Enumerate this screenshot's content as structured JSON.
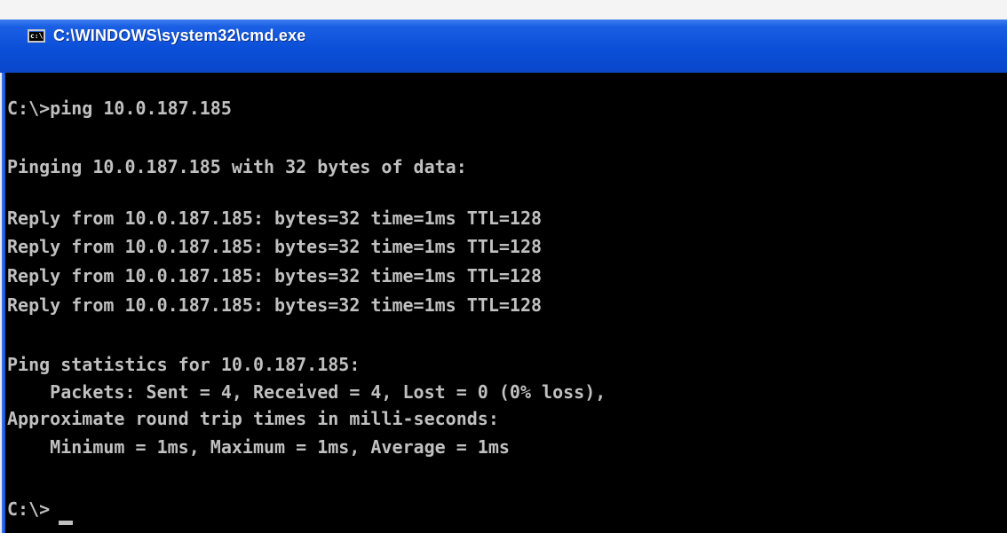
{
  "window": {
    "title": "C:\\WINDOWS\\system32\\cmd.exe",
    "icon_label": "c:\\"
  },
  "console": {
    "lines": [
      "C:\\>ping 10.0.187.185",
      "Pinging 10.0.187.185 with 32 bytes of data:",
      "Reply from 10.0.187.185: bytes=32 time=1ms TTL=128",
      "Reply from 10.0.187.185: bytes=32 time=1ms TTL=128",
      "Reply from 10.0.187.185: bytes=32 time=1ms TTL=128",
      "Reply from 10.0.187.185: bytes=32 time=1ms TTL=128",
      "Ping statistics for 10.0.187.185:",
      "    Packets: Sent = 4, Received = 4, Lost = 0 (0% loss),",
      "Approximate round trip times in milli-seconds:",
      "    Minimum = 1ms, Maximum = 1ms, Average = 1ms",
      "C:\\>"
    ]
  },
  "colors": {
    "background": "#000000",
    "text": "#c0c0c0",
    "titlebar": "#0b4fd8",
    "title_text": "#ffffff"
  }
}
